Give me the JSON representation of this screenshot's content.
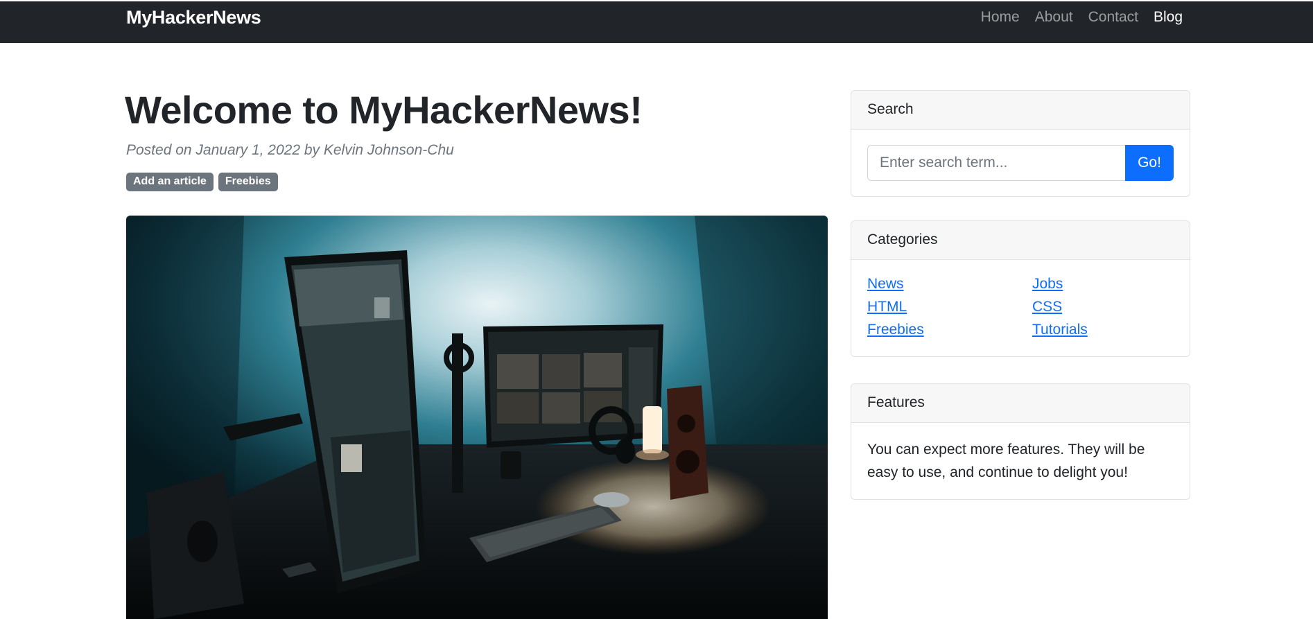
{
  "navbar": {
    "brand": "MyHackerNews",
    "links": [
      {
        "label": "Home",
        "active": false
      },
      {
        "label": "About",
        "active": false
      },
      {
        "label": "Contact",
        "active": false
      },
      {
        "label": "Blog",
        "active": true
      }
    ]
  },
  "post": {
    "title": "Welcome to MyHackerNews!",
    "meta": "Posted on January 1, 2022 by Kelvin Johnson-Chu",
    "badges": [
      "Add an article",
      "Freebies"
    ],
    "image_subject": "desk-setup-with-monitors"
  },
  "sidebar": {
    "search": {
      "header": "Search",
      "placeholder": "Enter search term...",
      "button_label": "Go!"
    },
    "categories": {
      "header": "Categories",
      "items": [
        "News",
        "Jobs",
        "HTML",
        "CSS",
        "Freebies",
        "Tutorials"
      ]
    },
    "features": {
      "header": "Features",
      "body": "You can expect more features. They will be easy to use, and continue to delight you!"
    }
  },
  "colors": {
    "navbar_bg": "#212529",
    "primary": "#0d6efd",
    "badge_bg": "#6c757d",
    "muted_text": "#6c757d"
  }
}
